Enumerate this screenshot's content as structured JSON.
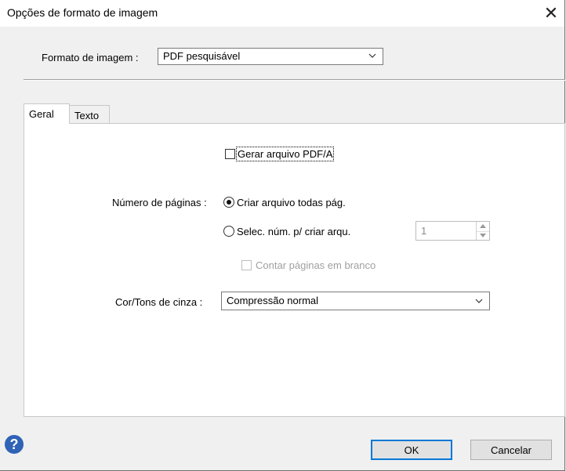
{
  "window": {
    "title": "Opções de formato de imagem",
    "close_glyph": "✕"
  },
  "format": {
    "label": "Formato de imagem :",
    "value": "PDF pesquisável"
  },
  "tabs": [
    {
      "label": "Geral",
      "active": true
    },
    {
      "label": "Texto",
      "active": false
    }
  ],
  "general": {
    "pdfa_checkbox_label": "Gerar arquivo PDF/A",
    "pdfa_checked": false,
    "pages_label": "Número de páginas :",
    "radio_all_label": "Criar arquivo todas pág.",
    "radio_all_selected": true,
    "radio_select_label": "Selec. núm. p/ criar arqu.",
    "radio_select_selected": false,
    "pages_count_value": "1",
    "blank_pages_label": "Contar páginas em branco",
    "blank_pages_checked": false,
    "color_label": "Cor/Tons de cinza :",
    "color_value": "Compressão normal"
  },
  "buttons": {
    "ok": "OK",
    "cancel": "Cancelar",
    "help_glyph": "?"
  },
  "colors": {
    "help_icon": "#2f63b6",
    "default_button_border": "#0078d7"
  }
}
